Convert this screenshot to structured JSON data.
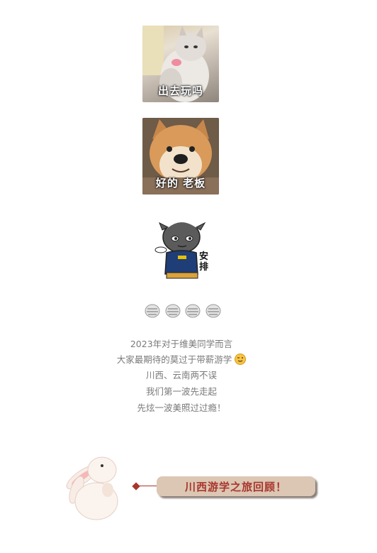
{
  "memes": [
    {
      "caption": "出去玩吗"
    },
    {
      "caption": "好的 老板"
    }
  ],
  "sticker": {
    "text1": "安",
    "text2": "排"
  },
  "paragraph": {
    "line1": "2023年对于维美同学而言",
    "line2": "大家最期待的莫过于带薪游学",
    "line3": "川西、云南两不误",
    "line4": "我们第一波先走起",
    "line5": "先炫一波美照过过瘾！"
  },
  "section": {
    "title": "川西游学之旅回顾！"
  },
  "colors": {
    "title_bg": "#dcc6b4",
    "title_text": "#a8362c",
    "diamond": "#a8362c"
  }
}
